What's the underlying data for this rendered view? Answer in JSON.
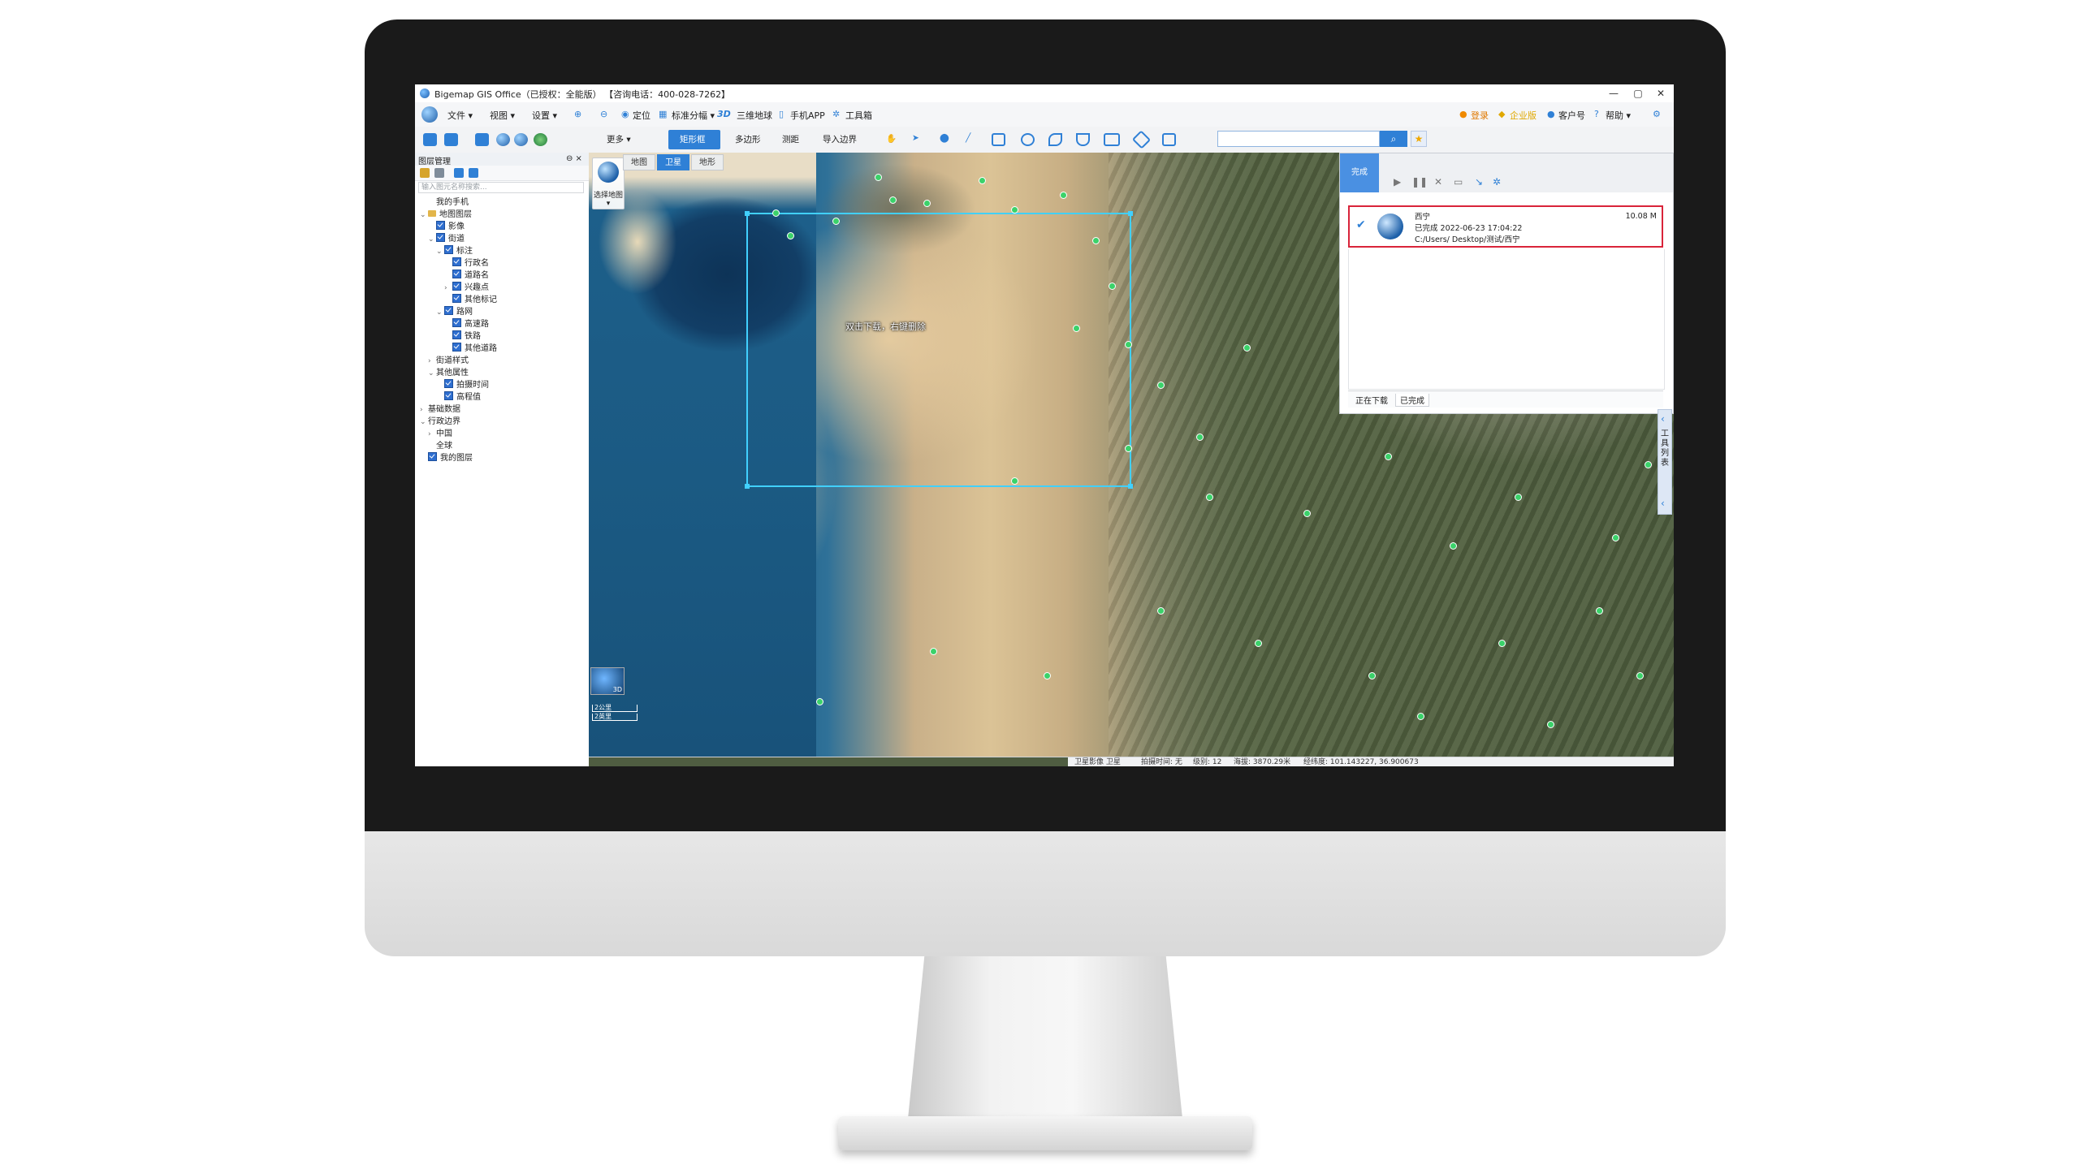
{
  "window": {
    "title": "Bigemap GIS Office（已授权：全能版）    【咨询电话：400-028-7262】",
    "controls": [
      "—",
      "▢",
      "✕"
    ]
  },
  "menu": {
    "items": [
      "文件 ▾",
      "视图 ▾",
      "设置 ▾",
      "定位",
      "标准分幅 ▾",
      "3D",
      "三维地球",
      "手机APP",
      "工具箱"
    ],
    "right": [
      "登录",
      "企业版",
      "客户号",
      "帮助 ▾"
    ]
  },
  "toolbar": {
    "more": "更多 ▾",
    "tools": [
      "矩形框",
      "多边形",
      "测距",
      "导入边界"
    ],
    "search_placeholder": ""
  },
  "layers_panel": {
    "title": "图层管理",
    "pin": "⊖ ×",
    "search_placeholder": "输入图元名称搜索...",
    "tree": [
      {
        "label": "我的手机",
        "level": 1,
        "checked": false,
        "exp": ""
      },
      {
        "label": "地图图层",
        "level": 0,
        "checked": false,
        "exp": "⌄",
        "folder": true
      },
      {
        "label": "影像",
        "level": 1,
        "checked": true,
        "exp": ""
      },
      {
        "label": "街道",
        "level": 1,
        "checked": true,
        "exp": "⌄"
      },
      {
        "label": "标注",
        "level": 2,
        "checked": true,
        "exp": "⌄"
      },
      {
        "label": "行政名",
        "level": 3,
        "checked": true,
        "exp": ""
      },
      {
        "label": "道路名",
        "level": 3,
        "checked": true,
        "exp": ""
      },
      {
        "label": "兴趣点",
        "level": 3,
        "checked": true,
        "exp": "›"
      },
      {
        "label": "其他标记",
        "level": 3,
        "checked": true,
        "exp": ""
      },
      {
        "label": "路网",
        "level": 2,
        "checked": true,
        "exp": "⌄"
      },
      {
        "label": "高速路",
        "level": 3,
        "checked": true,
        "exp": ""
      },
      {
        "label": "铁路",
        "level": 3,
        "checked": true,
        "exp": ""
      },
      {
        "label": "其他道路",
        "level": 3,
        "checked": true,
        "exp": ""
      },
      {
        "label": "街道样式",
        "level": 1,
        "checked": false,
        "exp": "›"
      },
      {
        "label": "其他属性",
        "level": 1,
        "checked": false,
        "exp": "⌄"
      },
      {
        "label": "拍摄时间",
        "level": 2,
        "checked": true,
        "exp": ""
      },
      {
        "label": "高程值",
        "level": 2,
        "checked": true,
        "exp": ""
      },
      {
        "label": "基础数据",
        "level": 0,
        "checked": false,
        "exp": "›"
      },
      {
        "label": "行政边界",
        "level": 0,
        "checked": false,
        "exp": "⌄"
      },
      {
        "label": "中国",
        "level": 1,
        "checked": false,
        "exp": "›"
      },
      {
        "label": "全球",
        "level": 1,
        "checked": false,
        "exp": ""
      },
      {
        "label": "我的图层",
        "level": 0,
        "checked": true,
        "exp": ""
      }
    ]
  },
  "map": {
    "tabs": [
      "地图",
      "卫星",
      "地形"
    ],
    "active_tab": "卫星",
    "select_map_label": "选择地图▾",
    "hint": "双击下载，右键删除",
    "scale": [
      "2公里",
      "2英里"
    ],
    "minimap_label": "3D"
  },
  "download_panel": {
    "done_tab": "完成",
    "task": {
      "name": "西宁",
      "status": "已完成 2022-06-23 17:04:22",
      "path": "C:/Users/        Desktop/测试/西宁",
      "size": "10.08 M"
    },
    "tabs": [
      "正在下载",
      "已完成"
    ],
    "active_tab": "已完成"
  },
  "side_panel": {
    "label": "工具列表"
  },
  "statusbar": {
    "source": "卫星影像 卫星",
    "shot_time": "拍摄时间: 无",
    "level": "级别:  12",
    "elevation": "海拔: 3870.29米",
    "coords": "经纬度:  101.143227, 36.900673"
  },
  "colors": {
    "accent": "#2f80d6",
    "highlight": "#d9243a",
    "selection": "#41d0ff"
  }
}
